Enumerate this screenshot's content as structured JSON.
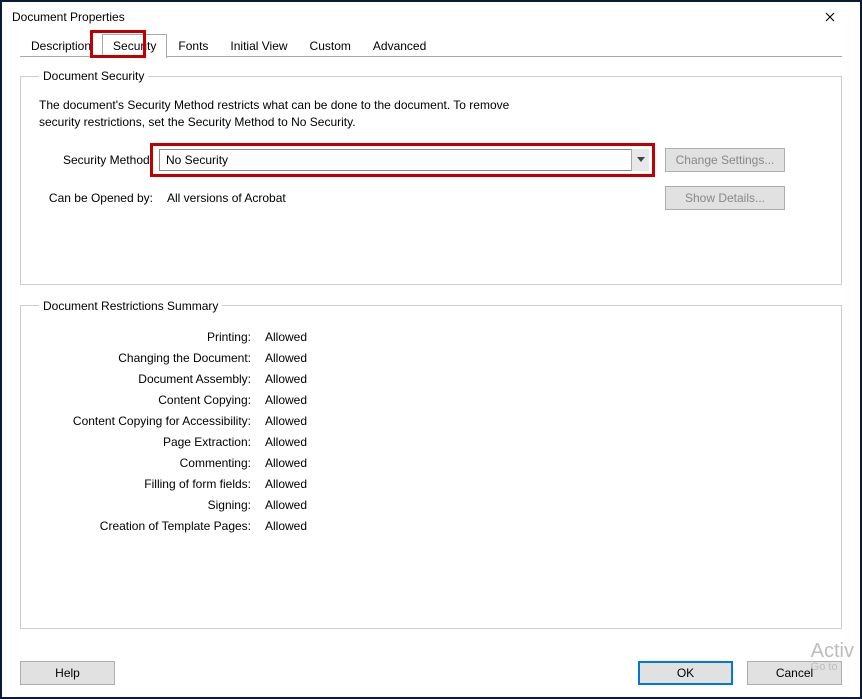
{
  "window": {
    "title": "Document Properties"
  },
  "tabs": {
    "items": [
      "Description",
      "Security",
      "Fonts",
      "Initial View",
      "Custom",
      "Advanced"
    ],
    "active_index": 1
  },
  "security_group": {
    "legend": "Document Security",
    "description": "The document's Security Method restricts what can be done to the document. To remove\nsecurity restrictions, set the Security Method to No Security.",
    "method_label": "Security Method:",
    "method_value": "No Security",
    "change_settings_label": "Change Settings...",
    "opened_by_label": "Can be Opened by:",
    "opened_by_value": "All versions of Acrobat",
    "show_details_label": "Show Details..."
  },
  "restrictions_group": {
    "legend": "Document Restrictions Summary",
    "rows": [
      {
        "label": "Printing:",
        "value": "Allowed"
      },
      {
        "label": "Changing the Document:",
        "value": "Allowed"
      },
      {
        "label": "Document Assembly:",
        "value": "Allowed"
      },
      {
        "label": "Content Copying:",
        "value": "Allowed"
      },
      {
        "label": "Content Copying for Accessibility:",
        "value": "Allowed"
      },
      {
        "label": "Page Extraction:",
        "value": "Allowed"
      },
      {
        "label": "Commenting:",
        "value": "Allowed"
      },
      {
        "label": "Filling of form fields:",
        "value": "Allowed"
      },
      {
        "label": "Signing:",
        "value": "Allowed"
      },
      {
        "label": "Creation of Template Pages:",
        "value": "Allowed"
      }
    ]
  },
  "footer": {
    "help": "Help",
    "ok": "OK",
    "cancel": "Cancel"
  },
  "watermark": {
    "line1": "Activ",
    "line2": "Go to"
  }
}
